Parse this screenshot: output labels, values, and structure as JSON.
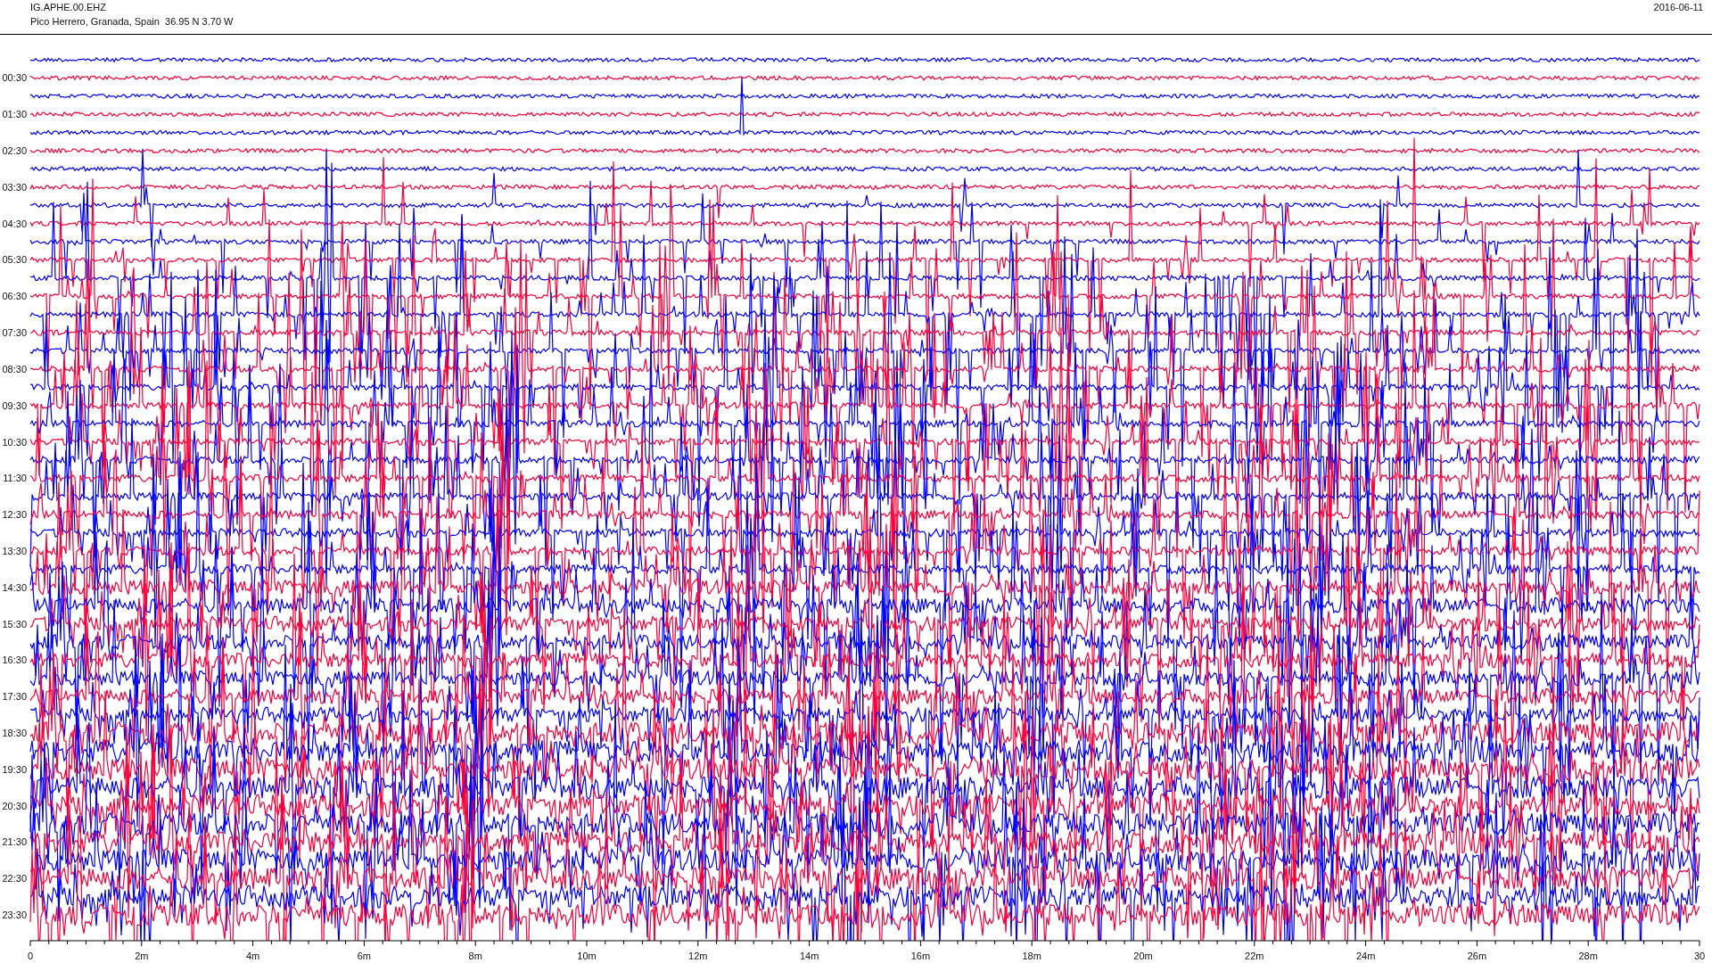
{
  "header": {
    "station": "IG.APHE.00.EHZ",
    "location": "Pico Herrero, Granada, Spain  36.95 N 3.70 W",
    "date": "2016-06-11"
  },
  "helicorder": {
    "row_labels": [
      "00:30",
      "01:30",
      "02:30",
      "03:30",
      "04:30",
      "05:30",
      "06:30",
      "07:30",
      "08:30",
      "09:30",
      "10:30",
      "11:30",
      "12:30",
      "13:30",
      "14:30",
      "15:30",
      "16:30",
      "17:30",
      "18:30",
      "19:30",
      "20:30",
      "21:30",
      "22:30",
      "23:30"
    ],
    "x_ticks": [
      "0",
      "2m",
      "4m",
      "6m",
      "8m",
      "10m",
      "12m",
      "14m",
      "16m",
      "18m",
      "20m",
      "22m",
      "24m",
      "26m",
      "28m",
      "30"
    ]
  }
}
